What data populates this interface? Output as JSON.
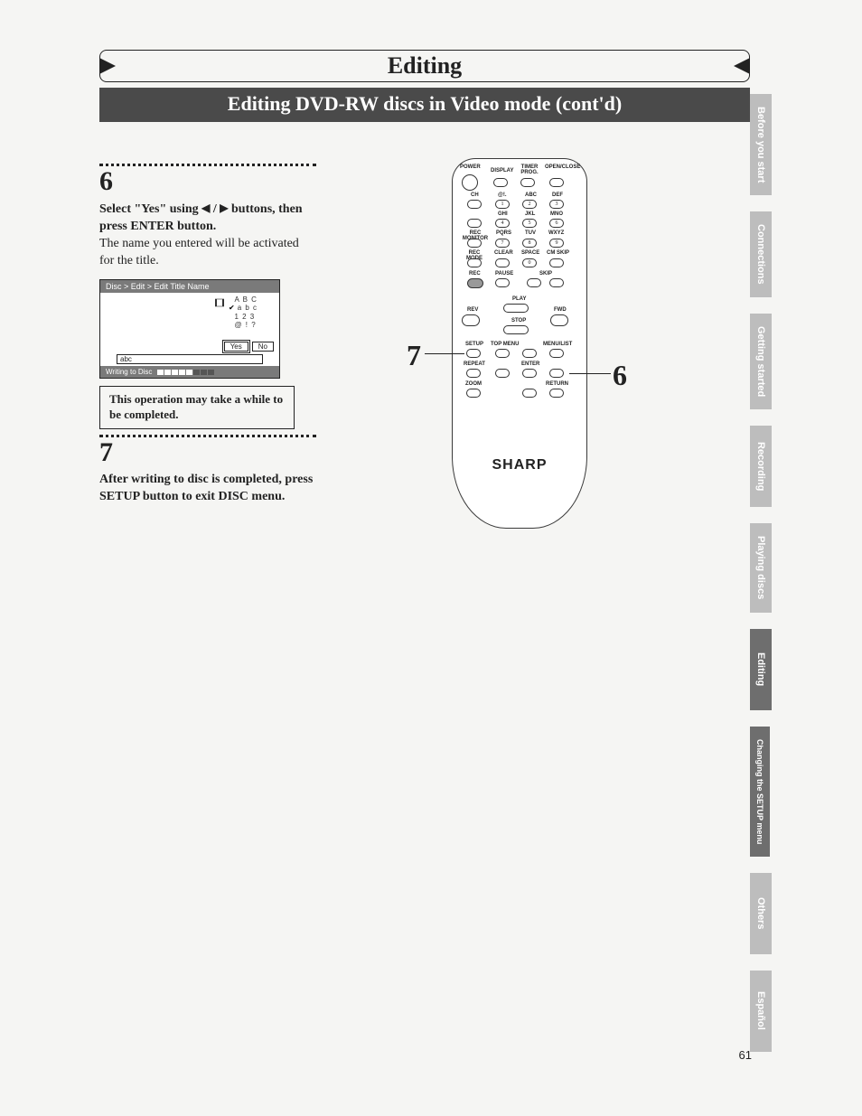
{
  "title": "Editing",
  "subtitle": "Editing DVD-RW discs in Video mode (cont'd)",
  "step6": {
    "num": "6",
    "line1a": "Select \"Yes\" using ",
    "line1b": " / ",
    "line1c": " buttons, then press ENTER button.",
    "line2": "The name you entered will be activated for the title."
  },
  "tv": {
    "breadcrumb": "Disc > Edit > Edit Title Name",
    "opt1": "A B C",
    "opt2": "a b c",
    "opt3": "1 2 3",
    "opt4": "@ ! ?",
    "btn_yes": "Yes",
    "btn_no": "No",
    "input_value": "abc",
    "footer_label": "Writing to Disc"
  },
  "note": "This operation may take a while to be completed.",
  "step7": {
    "num": "7",
    "text": "After writing to disc is completed, press SETUP button to exit DISC menu."
  },
  "remote": {
    "labels": {
      "power": "POWER",
      "display": "DISPLAY",
      "timer_prog": "TIMER PROG.",
      "open_close": "OPEN/CLOSE",
      "ch": "CH",
      "at1": "@!.",
      "abc": "ABC",
      "def": "DEF",
      "ghi": "GHI",
      "jkl": "JKL",
      "mno": "MNO",
      "rec_monitor": "REC MONITOR",
      "pqrs": "PQRS",
      "tuv": "TUV",
      "wxyz": "WXYZ",
      "rec_mode": "REC MODE",
      "clear": "CLEAR",
      "space": "SPACE",
      "cm_skip": "CM SKIP",
      "rec": "REC",
      "pause": "PAUSE",
      "skip": "SKIP",
      "play": "PLAY",
      "rev": "REV",
      "fwd": "FWD",
      "stop": "STOP",
      "setup": "SETUP",
      "top_menu": "TOP MENU",
      "menu_list": "MENU/LIST",
      "repeat": "REPEAT",
      "enter": "ENTER",
      "zoom": "ZOOM",
      "return": "RETURN",
      "n1": "1",
      "n2": "2",
      "n3": "3",
      "n4": "4",
      "n5": "5",
      "n6": "6",
      "n7": "7",
      "n8": "8",
      "n9": "9",
      "n0": "0"
    },
    "brand": "SHARP"
  },
  "callouts": {
    "left": "7",
    "right": "6"
  },
  "tabs": [
    "Before you start",
    "Connections",
    "Getting started",
    "Recording",
    "Playing discs",
    "Editing",
    "Changing the SETUP menu",
    "Others",
    "Español"
  ],
  "page_number": "61"
}
